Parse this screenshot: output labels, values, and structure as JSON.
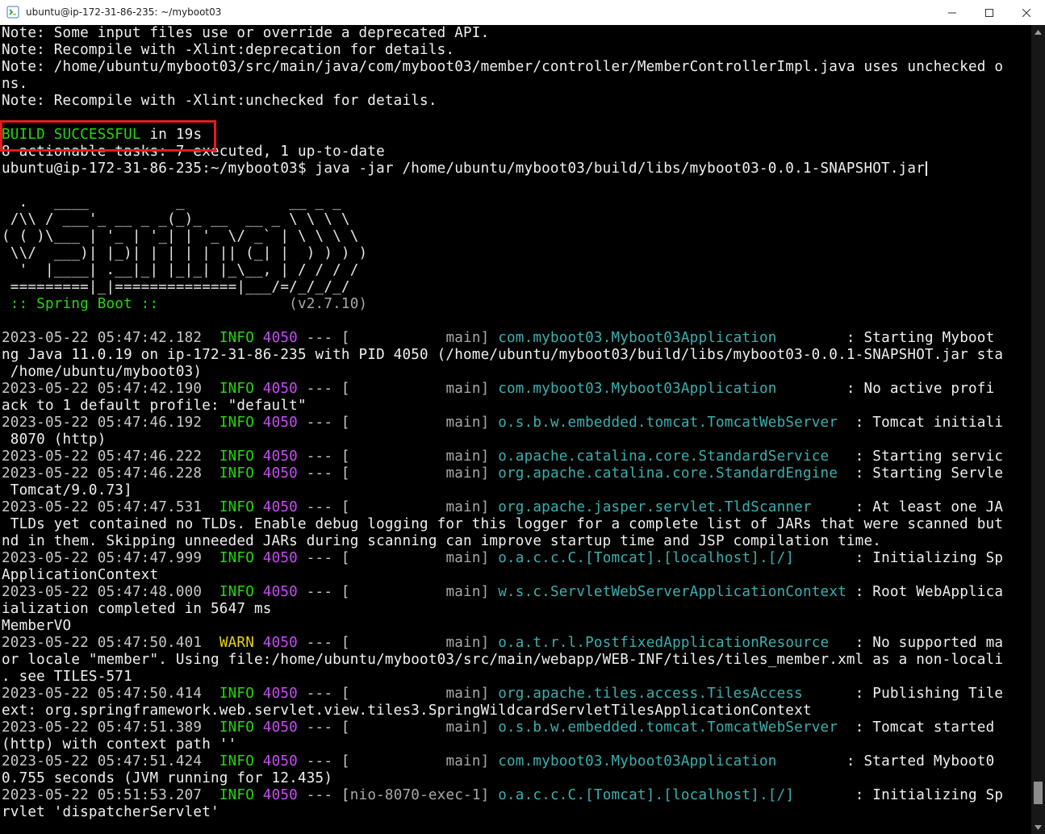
{
  "window": {
    "title": "ubuntu@ip-172-31-86-235: ~/myboot03",
    "icon": "terminal-app-icon",
    "controls": [
      "minimize",
      "maximize",
      "close"
    ]
  },
  "colors": {
    "background": "#000000",
    "text": "#f0f0f0",
    "success_green": "#24d90a",
    "pid_magenta": "#c84cf5",
    "warn_yellow": "#e8d40e",
    "logger_cyan": "#3ab0b0",
    "highlight_red": "#e41b1b"
  },
  "lines": {
    "l01": "Note: Some input files use or override a deprecated API.",
    "l02": "Note: Recompile with -Xlint:deprecation for details.",
    "l03": "Note: /home/ubuntu/myboot03/src/main/java/com/myboot03/member/controller/MemberControllerImpl.java uses unchecked o",
    "l04": "ns.",
    "l05": "Note: Recompile with -Xlint:unchecked for details.",
    "l06_a": "BUILD SUCCESSFUL",
    "l06_b": " in 19s",
    "l07": "8 actionable tasks: 7 executed, 1 up-to-date",
    "l08": "ubuntu@ip-172-31-86-235:~/myboot03$ java -jar /home/ubuntu/myboot03/build/libs/myboot03-0.0.1-SNAPSHOT.jar",
    "banner1": "  .   ____          _            __ _ _",
    "banner2": " /\\\\ / ___'_ __ _ _(_)_ __  __ _ \\ \\ \\ \\",
    "banner3": "( ( )\\___ | '_ | '_| | '_ \\/ _` | \\ \\ \\ \\",
    "banner4": " \\\\/  ___)| |_)| | | | | || (_| |  ) ) ) )",
    "banner5": "  '  |____| .__|_| |_|_| |_\\__, | / / / /",
    "banner6": " =========|_|==============|___/=/_/_/_/",
    "banner7_a": " :: Spring Boot :: ",
    "banner7_b": "              (v2.7.10)",
    "log": [
      {
        "ts": "2023-05-22 05:47:42.182",
        "level": "INFO",
        "pid": "4050",
        "sep": " --- [",
        "thread": "           main]",
        "logger": "com.myboot03.Myboot03Application",
        "msg": "        : Starting Myboot",
        "cont": [
          "ng Java 11.0.19 on ip-172-31-86-235 with PID 4050 (/home/ubuntu/myboot03/build/libs/myboot03-0.0.1-SNAPSHOT.jar sta",
          " /home/ubuntu/myboot03)"
        ]
      },
      {
        "ts": "2023-05-22 05:47:42.190",
        "level": "INFO",
        "pid": "4050",
        "sep": " --- [",
        "thread": "           main]",
        "logger": "com.myboot03.Myboot03Application",
        "msg": "        : No active profi",
        "cont": [
          "ack to 1 default profile: \"default\""
        ]
      },
      {
        "ts": "2023-05-22 05:47:46.192",
        "level": "INFO",
        "pid": "4050",
        "sep": " --- [",
        "thread": "           main]",
        "logger": "o.s.b.w.embedded.tomcat.TomcatWebServer",
        "msg": "  : Tomcat initiali",
        "cont": [
          " 8070 (http)"
        ]
      },
      {
        "ts": "2023-05-22 05:47:46.222",
        "level": "INFO",
        "pid": "4050",
        "sep": " --- [",
        "thread": "           main]",
        "logger": "o.apache.catalina.core.StandardService",
        "msg": "   : Starting servic",
        "cont": []
      },
      {
        "ts": "2023-05-22 05:47:46.228",
        "level": "INFO",
        "pid": "4050",
        "sep": " --- [",
        "thread": "           main]",
        "logger": "org.apache.catalina.core.StandardEngine",
        "msg": "  : Starting Servle",
        "cont": [
          " Tomcat/9.0.73]"
        ]
      },
      {
        "ts": "2023-05-22 05:47:47.531",
        "level": "INFO",
        "pid": "4050",
        "sep": " --- [",
        "thread": "           main]",
        "logger": "org.apache.jasper.servlet.TldScanner",
        "msg": "     : At least one JA",
        "cont": [
          " TLDs yet contained no TLDs. Enable debug logging for this logger for a complete list of JARs that were scanned but",
          "nd in them. Skipping unneeded JARs during scanning can improve startup time and JSP compilation time."
        ]
      },
      {
        "ts": "2023-05-22 05:47:47.999",
        "level": "INFO",
        "pid": "4050",
        "sep": " --- [",
        "thread": "           main]",
        "logger": "o.a.c.c.C.[Tomcat].[localhost].[/]",
        "msg": "       : Initializing Sp",
        "cont": [
          "ApplicationContext"
        ]
      },
      {
        "ts": "2023-05-22 05:47:48.000",
        "level": "INFO",
        "pid": "4050",
        "sep": " --- [",
        "thread": "           main]",
        "logger": "w.s.c.ServletWebServerApplicationContext",
        "msg": " : Root WebApplica",
        "cont": [
          "ialization completed in 5647 ms",
          "MemberVO"
        ]
      },
      {
        "ts": "2023-05-22 05:47:50.401",
        "level": "WARN",
        "pid": "4050",
        "sep": " --- [",
        "thread": "           main]",
        "logger": "o.a.t.r.l.PostfixedApplicationResource",
        "msg": "   : No supported ma",
        "cont": [
          "or locale \"member\". Using file:/home/ubuntu/myboot03/src/main/webapp/WEB-INF/tiles/tiles_member.xml as a non-locali",
          ". see TILES-571"
        ]
      },
      {
        "ts": "2023-05-22 05:47:50.414",
        "level": "INFO",
        "pid": "4050",
        "sep": " --- [",
        "thread": "           main]",
        "logger": "org.apache.tiles.access.TilesAccess",
        "msg": "      : Publishing Tile",
        "cont": [
          "ext: org.springframework.web.servlet.view.tiles3.SpringWildcardServletTilesApplicationContext"
        ]
      },
      {
        "ts": "2023-05-22 05:47:51.389",
        "level": "INFO",
        "pid": "4050",
        "sep": " --- [",
        "thread": "           main]",
        "logger": "o.s.b.w.embedded.tomcat.TomcatWebServer",
        "msg": "  : Tomcat started ",
        "cont": [
          "(http) with context path ''"
        ]
      },
      {
        "ts": "2023-05-22 05:47:51.424",
        "level": "INFO",
        "pid": "4050",
        "sep": " --- [",
        "thread": "           main]",
        "logger": "com.myboot03.Myboot03Application",
        "msg": "        : Started Myboot0",
        "cont": [
          "0.755 seconds (JVM running for 12.435)"
        ]
      },
      {
        "ts": "2023-05-22 05:51:53.207",
        "level": "INFO",
        "pid": "4050",
        "sep": " --- [",
        "thread": "nio-8070-exec-1]",
        "logger": "o.a.c.c.C.[Tomcat].[localhost].[/]",
        "msg": "       : Initializing Sp",
        "cont": [
          "rvlet 'dispatcherServlet'"
        ]
      }
    ]
  }
}
